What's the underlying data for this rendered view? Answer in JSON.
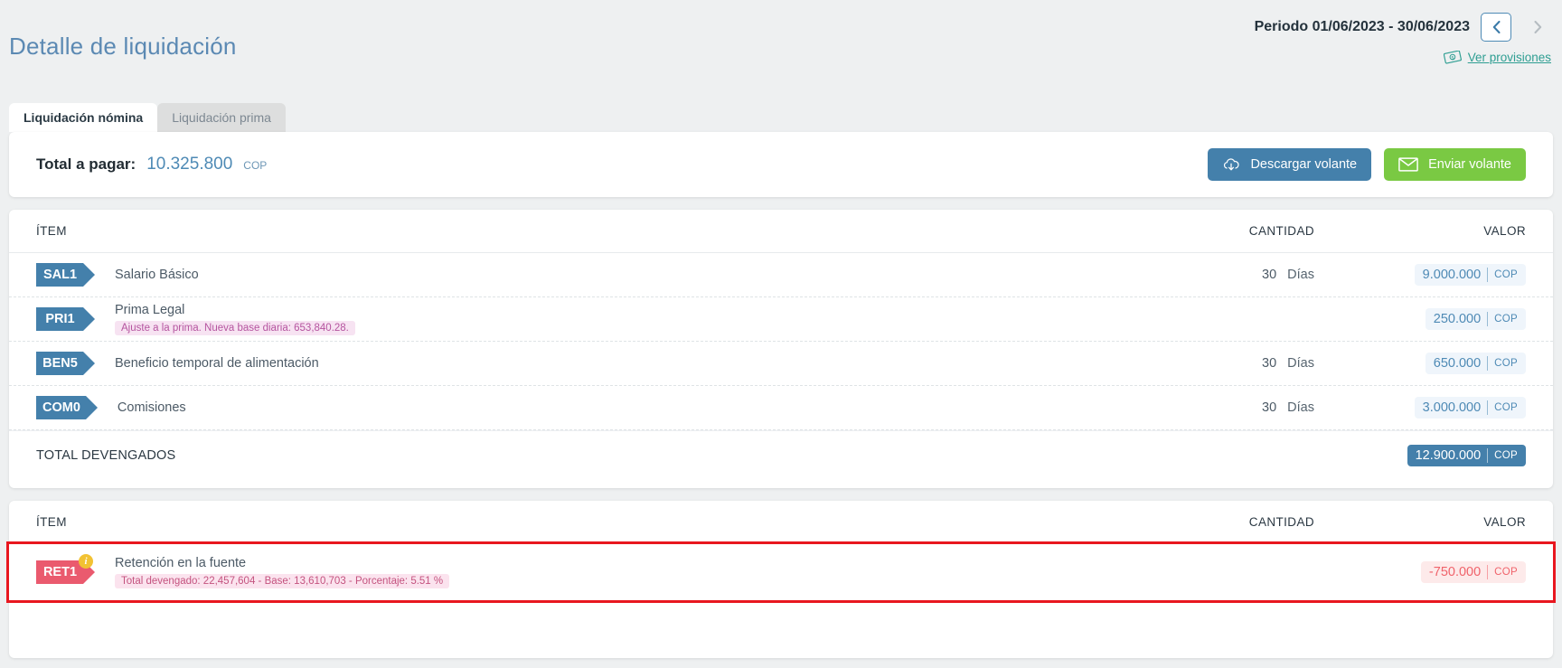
{
  "header": {
    "title": "Detalle de liquidación",
    "period_label": "Periodo 01/06/2023 - 30/06/2023",
    "prev_icon": "chevron-left-icon",
    "next_icon": "chevron-right-icon",
    "provisions_link": "Ver provisiones",
    "provisions_icon": "money-bill-icon"
  },
  "tabs": [
    {
      "label": "Liquidación nómina",
      "active": true
    },
    {
      "label": "Liquidación prima",
      "active": false
    }
  ],
  "total_panel": {
    "label": "Total a pagar:",
    "value": "10.325.800",
    "currency": "COP",
    "download_button": "Descargar volante",
    "download_icon": "cloud-download-icon",
    "send_button": "Enviar volante",
    "send_icon": "envelope-icon"
  },
  "devengados": {
    "columns": {
      "item": "ÍTEM",
      "cantidad": "CANTIDAD",
      "valor": "VALOR"
    },
    "rows": [
      {
        "code": "SAL1",
        "name": "Salario Básico",
        "note": "",
        "quantity": "30",
        "unit": "Días",
        "value": "9.000.000",
        "currency": "COP"
      },
      {
        "code": "PRI1",
        "name": "Prima Legal",
        "note": "Ajuste a la prima. Nueva base diaria: 653,840.28.",
        "quantity": "",
        "unit": "",
        "value": "250.000",
        "currency": "COP"
      },
      {
        "code": "BEN5",
        "name": "Beneficio temporal de alimentación",
        "note": "",
        "quantity": "30",
        "unit": "Días",
        "value": "650.000",
        "currency": "COP"
      },
      {
        "code": "COM0",
        "name": "Comisiones",
        "note": "",
        "quantity": "30",
        "unit": "Días",
        "value": "3.000.000",
        "currency": "COP"
      }
    ],
    "total_label": "TOTAL DEVENGADOS",
    "total_value": "12.900.000",
    "total_currency": "COP"
  },
  "deducciones": {
    "columns": {
      "item": "ÍTEM",
      "cantidad": "CANTIDAD",
      "valor": "VALOR"
    },
    "rows": [
      {
        "code": "RET1",
        "badge_info_icon": "info-icon",
        "name": "Retención en la fuente",
        "note": "Total devengado: 22,457,604 - Base: 13,610,703 - Porcentaje: 5.51 %",
        "quantity": "",
        "unit": "",
        "value": "-750.000",
        "currency": "COP",
        "highlighted": true
      }
    ]
  },
  "colors": {
    "brand_blue": "#4480ab",
    "title_blue": "#5b89b3",
    "green": "#7ac943",
    "teal_link": "#2e9e92",
    "danger_red": "#e8171f",
    "badge_red": "#ea5a6e",
    "info_yellow": "#f2c233",
    "note_pink": "#b5549f"
  }
}
